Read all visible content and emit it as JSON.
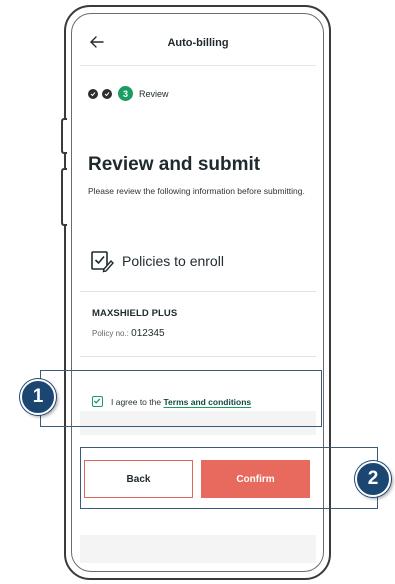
{
  "header": {
    "title": "Auto-billing",
    "back_icon": "arrow-left-icon"
  },
  "stepper": {
    "current_step": "3",
    "current_label": "Review",
    "completed_steps": 2
  },
  "page": {
    "title": "Review and submit",
    "intro": "Please review the following information before submitting."
  },
  "policies": {
    "section_label": "Policies to enroll",
    "icon": "checklist-edit-icon",
    "items": [
      {
        "name": "MAXSHIELD PLUS",
        "number_label": "Policy no.:",
        "number": "012345"
      }
    ]
  },
  "agreement": {
    "checked": true,
    "prefix": "I agree to the",
    "link_text": "Terms and conditions"
  },
  "actions": {
    "back_label": "Back",
    "confirm_label": "Confirm"
  },
  "annotations": [
    {
      "number": "1"
    },
    {
      "number": "2"
    }
  ],
  "colors": {
    "accent_green": "#1a9c63",
    "confirm_red": "#e8695d",
    "badge_blue": "#1c4672"
  }
}
